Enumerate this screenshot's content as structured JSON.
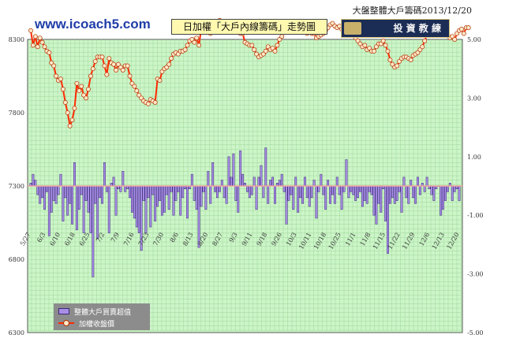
{
  "header": {
    "brand": "www.icoach5.com",
    "top_title": "大盤整體大戶籌碼2013/12/20",
    "banner": "日加權「大戶內線籌碼」走勢圖",
    "logo_text": "投 資 教 練"
  },
  "colors": {
    "plot_bg": "#ccf5c8",
    "grid": "#9fd69a",
    "bar_fill": "#a98ee6",
    "bar_stroke": "#3a2a7a",
    "line": "#ff2a00",
    "marker_fill": "#ffe9c9",
    "marker_stroke": "#b03000",
    "zero_line": "#f4a0a0"
  },
  "chart_data": {
    "type": "bar+line",
    "left_axis": {
      "ticks": [
        8300,
        7800,
        7300,
        6800,
        6300
      ],
      "range": [
        6300,
        8300
      ]
    },
    "right_axis": {
      "ticks": [
        "5.00",
        "3.00",
        "1.00",
        "-1.00",
        "-3.00",
        "-5.00"
      ],
      "range": [
        -5,
        5
      ]
    },
    "x_tick_labels": [
      "5/27",
      "6/3",
      "6/10",
      "6/18",
      "6/25",
      "7/2",
      "7/9",
      "7/16",
      "7/23",
      "7/30",
      "8/6",
      "8/13",
      "8/20",
      "8/27",
      "9/3",
      "9/11",
      "9/18",
      "9/26",
      "10/3",
      "10/11",
      "10/18",
      "10/25",
      "11/1",
      "11/8",
      "11/15",
      "11/22",
      "11/29",
      "12/6",
      "12/13",
      "12/20"
    ],
    "legend": [
      {
        "label": "整體大戶買賣超值",
        "kind": "bar"
      },
      {
        "label": "加權收盤價",
        "kind": "line"
      }
    ],
    "series": [
      {
        "name": "整體大戶買賣超值",
        "type": "bar",
        "values": [
          0.1,
          0.4,
          0.2,
          -0.3,
          -0.6,
          -0.4,
          -0.8,
          -0.2,
          -1.7,
          -0.9,
          -0.5,
          -0.6,
          -0.3,
          0.4,
          -1.2,
          -0.4,
          -1.0,
          -0.6,
          -1.3,
          0.8,
          -1.5,
          -0.8,
          -0.3,
          -1.6,
          -0.5,
          -0.9,
          -1.6,
          -3.1,
          -0.6,
          -1.8,
          -0.4,
          -0.6,
          0.8,
          -0.2,
          -1.6,
          0.1,
          0.3,
          -1.0,
          -0.1,
          -0.2,
          0.5,
          -0.2,
          -0.1,
          -0.4,
          -0.9,
          -1.1,
          -1.4,
          -1.6,
          -2.2,
          -0.5,
          -1.6,
          -0.4,
          -1.4,
          -0.3,
          -1.2,
          -0.7,
          -0.5,
          -1.0,
          -0.9,
          -0.3,
          -0.8,
          -0.2,
          -1.0,
          -0.5,
          -0.2,
          -1.0,
          -0.4,
          -0.1,
          -1.1,
          -0.1,
          0.4,
          -0.5,
          -0.8,
          -2.1,
          -0.7,
          -0.2,
          -0.8,
          0.5,
          -0.6,
          0.8,
          -0.2,
          -0.4,
          -0.2,
          0.2,
          -0.4,
          -0.6,
          1.0,
          0.3,
          1.1,
          -0.5,
          -0.9,
          1.2,
          0.4,
          0.1,
          -0.2,
          -0.4,
          -0.3,
          0.3,
          -0.8,
          0.3,
          0.7,
          -0.4,
          1.3,
          -0.6,
          0.2,
          0.3,
          -0.6,
          0.1,
          0.2,
          0.4,
          -0.2,
          -1.3,
          -0.5,
          -0.3,
          -0.8,
          0.3,
          -0.9,
          -0.4,
          -0.6,
          0.3,
          -0.4,
          -0.7,
          -0.4,
          0.2,
          -1.1,
          -0.2,
          0.4,
          -0.3,
          -0.8,
          0.2,
          -0.6,
          -0.3,
          -0.6,
          0.3,
          -0.3,
          -0.8,
          -0.2,
          0.9,
          -0.4,
          -0.2,
          -0.3,
          -0.5,
          -0.4,
          -0.2,
          -0.7,
          -0.5,
          -0.6,
          -0.2,
          -0.3,
          -1.0,
          -1.3,
          -0.6,
          -0.9,
          -0.1,
          -1.2,
          -2.3,
          -0.6,
          -0.4,
          -0.6,
          -0.5,
          -0.2,
          -0.9,
          0.3,
          -0.4,
          -0.6,
          0.2,
          -0.4,
          -0.6,
          0.3,
          -0.3,
          0.1,
          -0.2,
          0.3,
          -0.1,
          -0.3,
          -0.5,
          -0.1,
          0.0,
          -1.0,
          -0.8,
          -0.5,
          -0.2,
          0.1,
          -0.5,
          -0.2,
          -0.1,
          -0.5
        ]
      },
      {
        "name": "加權收盤價",
        "type": "line",
        "values": [
          8360,
          8260,
          8320,
          8250,
          8310,
          8280,
          8250,
          8220,
          8210,
          8140,
          8120,
          8050,
          8020,
          8030,
          7960,
          7870,
          7800,
          7710,
          7750,
          7830,
          8000,
          7950,
          7980,
          7920,
          7900,
          7960,
          8050,
          8100,
          8150,
          8180,
          8180,
          8180,
          8120,
          8060,
          8170,
          8140,
          8130,
          8090,
          8130,
          8110,
          8090,
          8120,
          8120,
          8050,
          8000,
          7980,
          7950,
          7920,
          7900,
          7880,
          7870,
          7860,
          7890,
          7880,
          7870,
          8030,
          8020,
          8080,
          8100,
          8110,
          8130,
          8170,
          8200,
          8210,
          8200,
          8220,
          8220,
          8230,
          8260,
          8290,
          8300,
          8280,
          8310,
          8260,
          8370,
          8380,
          8360,
          8390,
          8340,
          8370,
          8420,
          8400,
          8430,
          8410,
          8380,
          8360,
          8400,
          8390,
          8370,
          8370,
          8380,
          8340,
          8340,
          8280,
          8270,
          8260,
          8260,
          8230,
          8200,
          8180,
          8190,
          8200,
          8220,
          8250,
          8230,
          8240,
          8220,
          8260,
          8300,
          8320,
          8370,
          8400,
          8420,
          8400,
          8420,
          8380,
          8390,
          8380,
          8390,
          8360,
          8340,
          8370,
          8340,
          8340,
          8310,
          8320,
          8330,
          8340,
          8360,
          8380,
          8400,
          8410,
          8390,
          8380,
          8390,
          8370,
          8340,
          8360,
          8370,
          8340,
          8330,
          8310,
          8290,
          8270,
          8250,
          8260,
          8230,
          8240,
          8220,
          8220,
          8250,
          8270,
          8270,
          8290,
          8260,
          8220,
          8160,
          8130,
          8110,
          8120,
          8150,
          8170,
          8180,
          8180,
          8170,
          8160,
          8190,
          8200,
          8210,
          8230,
          8250,
          8290,
          8330,
          8370,
          8370,
          8390,
          8380,
          8360,
          8380,
          8360,
          8340,
          8330,
          8310,
          8320,
          8300,
          8340,
          8360,
          8370,
          8340,
          8380,
          8380
        ]
      }
    ]
  }
}
